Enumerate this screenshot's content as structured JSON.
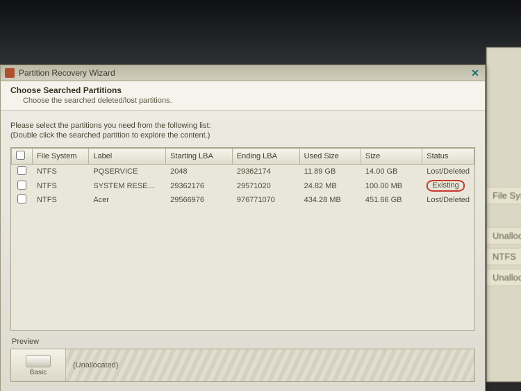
{
  "window": {
    "title": "Partition Recovery Wizard",
    "close_glyph": "✕"
  },
  "header": {
    "title": "Choose Searched Partitions",
    "subtitle": "Choose the searched deleted/lost partitions."
  },
  "instructions": {
    "line1": "Please select the partitions you need from the following list:",
    "line2": "(Double click the searched partition to explore the content.)"
  },
  "columns": {
    "chk": "",
    "fs": "File System",
    "label": "Label",
    "start": "Starting LBA",
    "end": "Ending LBA",
    "used": "Used Size",
    "size": "Size",
    "status": "Status"
  },
  "rows": [
    {
      "fs": "NTFS",
      "label": "PQSERVICE",
      "start": "2048",
      "end": "29362174",
      "used": "11.89 GB",
      "size": "14.00 GB",
      "status": "Lost/Deleted",
      "highlight": false
    },
    {
      "fs": "NTFS",
      "label": "SYSTEM RESE...",
      "start": "29362176",
      "end": "29571020",
      "used": "24.82 MB",
      "size": "100.00 MB",
      "status": "Existing",
      "highlight": true
    },
    {
      "fs": "NTFS",
      "label": "Acer",
      "start": "29566976",
      "end": "976771070",
      "used": "434.28 MB",
      "size": "451.66 GB",
      "status": "Lost/Deleted",
      "highlight": false
    }
  ],
  "preview": {
    "label": "Preview",
    "disk_label": "Basic",
    "bar_label": "(Unallocated)"
  },
  "bg": {
    "hdr": "File Syst",
    "r1": "Unalloca",
    "r2": "NTFS",
    "r3": "Unalloc"
  }
}
